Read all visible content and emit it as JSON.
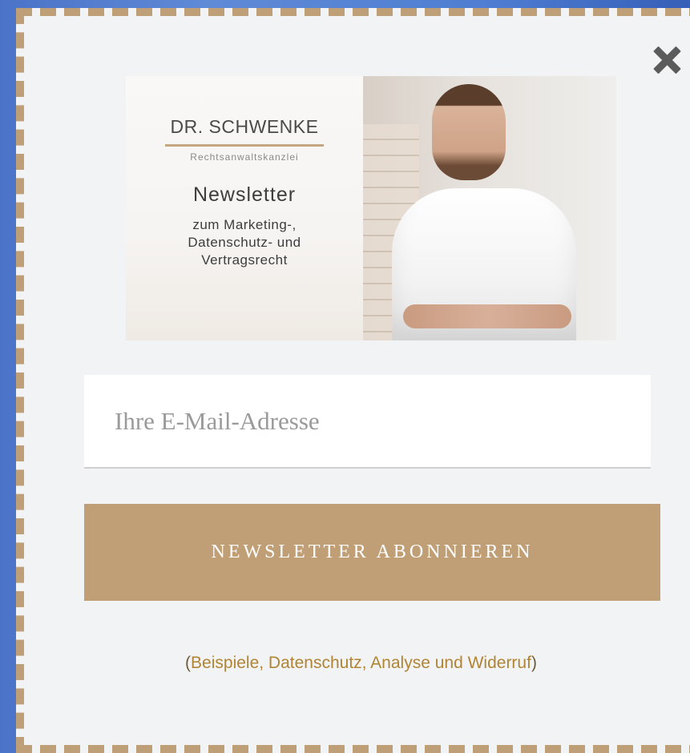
{
  "banner": {
    "brand_name": "DR. SCHWENKE",
    "brand_sub": "Rechtsanwaltskanzlei",
    "newsletter_title": "Newsletter",
    "newsletter_desc_line1": "zum Marketing-,",
    "newsletter_desc_line2": "Datenschutz- und",
    "newsletter_desc_line3": "Vertragsrecht"
  },
  "form": {
    "email_placeholder": "Ihre E-Mail-Adresse",
    "email_value": "",
    "subscribe_label": "NEWSLETTER ABONNIEREN"
  },
  "footer": {
    "paren_open": "(",
    "link_text": "Beispiele, Datenschutz, Analyse und Widerruf",
    "paren_close": ")"
  },
  "icons": {
    "close": "close-icon"
  },
  "colors": {
    "accent": "#c19f76",
    "border": "#bf9f77",
    "link": "#b18434"
  }
}
